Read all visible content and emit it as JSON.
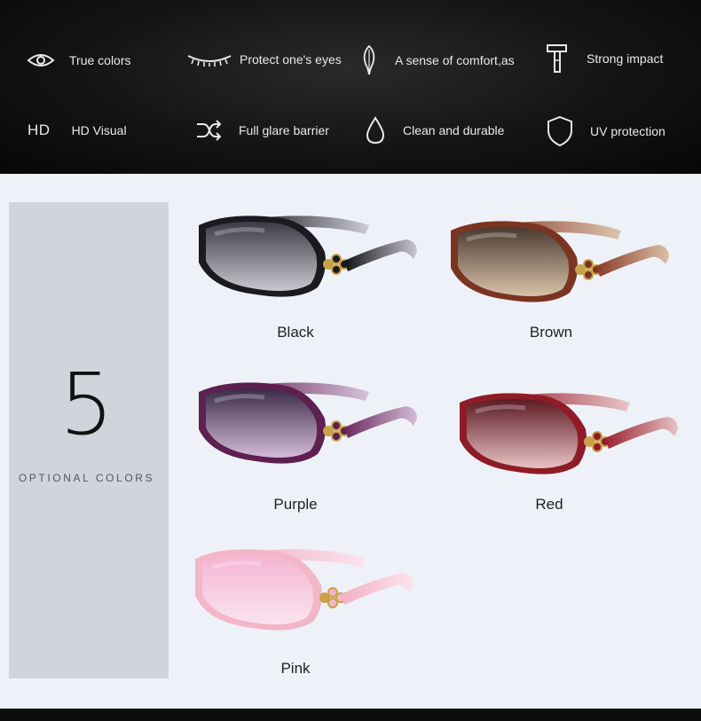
{
  "features": [
    {
      "icon": "eye-icon",
      "label": "True colors"
    },
    {
      "icon": "eyelash-icon",
      "label": "Protect one's eyes"
    },
    {
      "icon": "feather-icon",
      "label": "A sense of comfort,as"
    },
    {
      "icon": "hammer-icon",
      "label": "Strong impact"
    },
    {
      "icon": "hd-icon",
      "icon_text": "HD",
      "label": "HD Visual"
    },
    {
      "icon": "shuffle-icon",
      "label": "Full glare barrier"
    },
    {
      "icon": "droplet-icon",
      "label": "Clean and durable"
    },
    {
      "icon": "shield-icon",
      "label": "UV protection"
    }
  ],
  "options": {
    "count": "5",
    "caption": "OPTIONAL COLORS"
  },
  "products": [
    {
      "label": "Black",
      "frame": "#1a1a1f",
      "lens_top": "#3a3b44",
      "lens_bottom": "#c8c9cf",
      "temple": "#121216"
    },
    {
      "label": "Brown",
      "frame": "#7a3422",
      "lens_top": "#4a3a30",
      "lens_bottom": "#d9c2a8",
      "temple": "#8b3a28"
    },
    {
      "label": "Purple",
      "frame": "#5d2050",
      "lens_top": "#3a2a48",
      "lens_bottom": "#d4bcd8",
      "temple": "#6a2a5a"
    },
    {
      "label": "Red",
      "frame": "#8e1c26",
      "lens_top": "#5c1a22",
      "lens_bottom": "#e7c2c4",
      "temple": "#9a2230"
    },
    {
      "label": "Pink",
      "frame": "#f2b6c8",
      "lens_top": "#f3b5d2",
      "lens_bottom": "#fbe3ee",
      "temple": "#f0b0c4"
    }
  ]
}
